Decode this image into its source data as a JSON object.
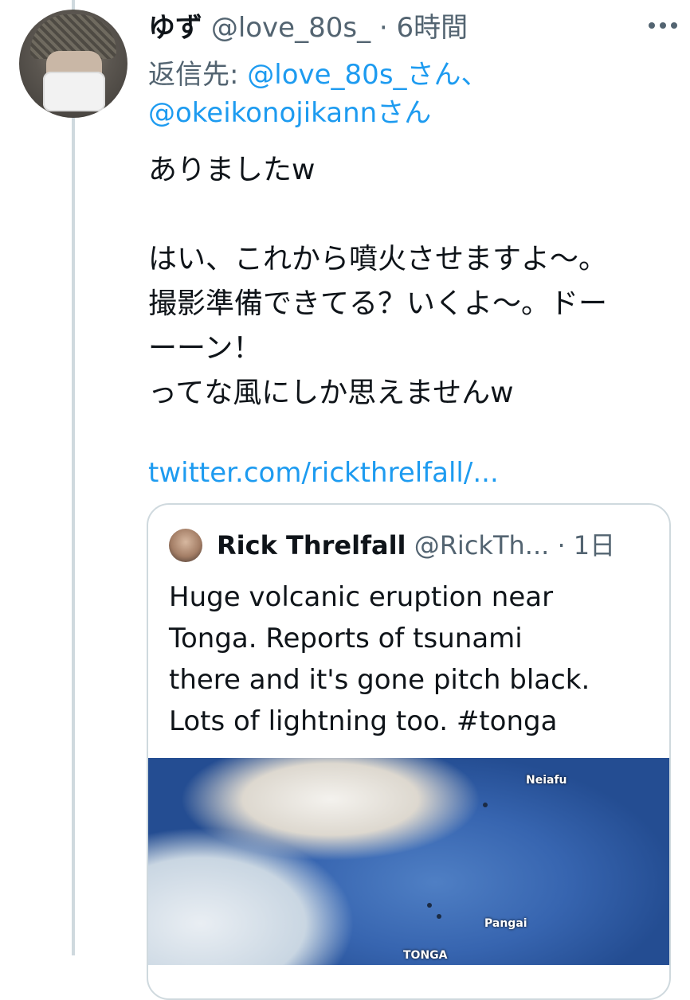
{
  "tweet": {
    "display_name": "ゆず",
    "handle": "@love_80s_",
    "separator": "·",
    "time": "6時間",
    "reply_label": "返信先: ",
    "reply_mention1": "@love_80s_さん、",
    "reply_mention2": "@okeikonojikannさん",
    "body_lines": [
      "ありましたw",
      "はい、これから噴火させますよ〜。",
      "撮影準備できてる？いくよ〜。ドー",
      "ーーン！",
      "ってな風にしか思えませんw"
    ],
    "link": "twitter.com/rickthrelfall/..."
  },
  "quote": {
    "display_name": "Rick Threlfall",
    "handle": "@RickTh...",
    "separator": "·",
    "time": "1日",
    "text_lines": [
      "Huge volcanic eruption near",
      "Tonga.  Reports of tsunami",
      "there and it's gone pitch black.",
      "Lots of lightning too. #tonga"
    ],
    "image_labels": {
      "neiafu": "Neiafu",
      "pangai": "Pangai",
      "tonga": "TONGA"
    }
  },
  "colors": {
    "link_blue": "#1d9bf0",
    "secondary_text": "#536471",
    "border": "#cfd9de"
  }
}
